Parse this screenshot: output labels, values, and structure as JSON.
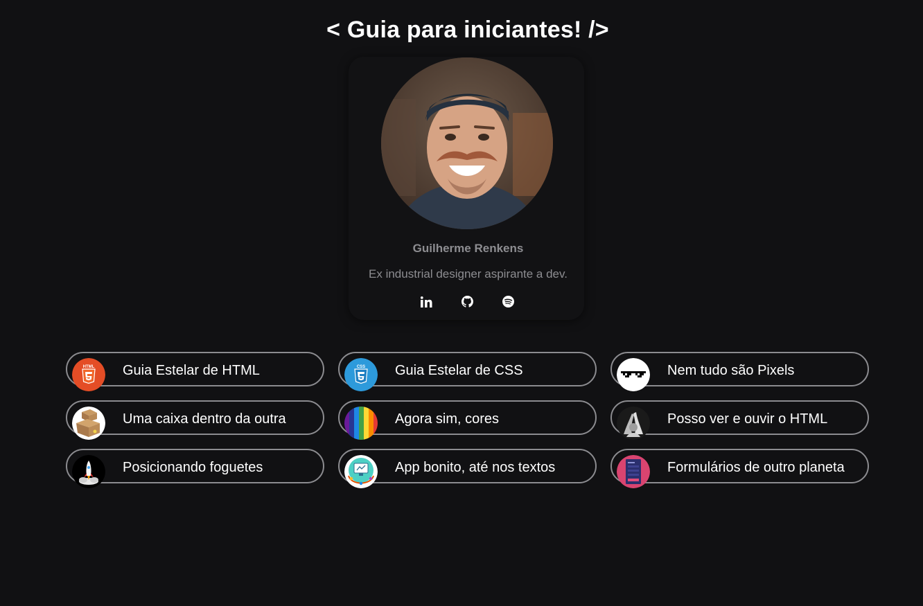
{
  "page": {
    "title": "< Guia para iniciantes! />"
  },
  "profile": {
    "name": "Guilherme Renkens",
    "bio": "Ex industrial designer aspirante a dev.",
    "avatar_icon": "profile-photo",
    "social": [
      {
        "icon": "linkedin-icon"
      },
      {
        "icon": "github-icon"
      },
      {
        "icon": "spotify-icon"
      }
    ]
  },
  "links": [
    {
      "label": "Guia Estelar de HTML",
      "icon": "html5-icon"
    },
    {
      "label": "Guia Estelar de CSS",
      "icon": "css3-icon"
    },
    {
      "label": "Nem tudo são Pixels",
      "icon": "pixel-sunglasses-icon"
    },
    {
      "label": "Uma caixa dentro da outra",
      "icon": "cardboard-boxes-icon"
    },
    {
      "label": "Agora sim, cores",
      "icon": "rainbow-icon"
    },
    {
      "label": "Posso ver e ouvir o HTML",
      "icon": "accessibility-hands-icon"
    },
    {
      "label": "Posicionando foguetes",
      "icon": "rocket-icon"
    },
    {
      "label": "App bonito, até nos textos",
      "icon": "app-design-icon"
    },
    {
      "label": "Formulários de outro planeta",
      "icon": "form-icon"
    }
  ],
  "colors": {
    "background": "#111113",
    "card_border": "#8c8c90",
    "muted_text": "#8d8d91",
    "html_orange": "#e44d26",
    "css_blue": "#2d9adb"
  }
}
